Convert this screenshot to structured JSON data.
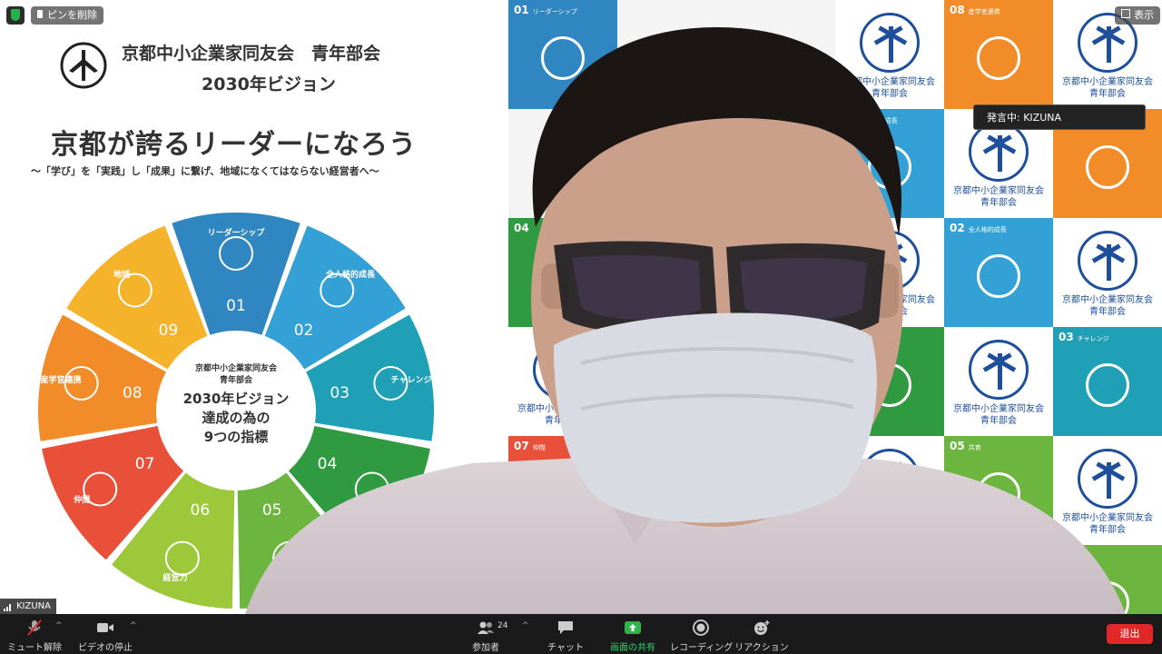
{
  "top": {
    "pin_label": "ピンを削除",
    "view_label": "表示"
  },
  "speaker_tooltip": "発言中: KIZUNA",
  "participant_name": "KIZUNA",
  "slide": {
    "org_line1": "京都中小企業家同友会　青年部会",
    "org_line2": "2030年ビジョン",
    "headline": "京都が誇るリーダーになろう",
    "subtitle": "〜「学び」を「実践」し「成果」に繋げ、地域になくてはならない経営者へ〜",
    "center_line1": "京都中小企業家同友会",
    "center_line2": "青年部会",
    "center_line3": "2030年ビジョン",
    "center_line4": "達成の為の",
    "center_line5": "9つの指標",
    "segments": [
      {
        "num": "01",
        "label": "リーダーシップ",
        "color": "#2f86c0"
      },
      {
        "num": "02",
        "label": "全人格的成長",
        "color": "#33a1d6"
      },
      {
        "num": "03",
        "label": "チャレンジ",
        "color": "#1fa0b6"
      },
      {
        "num": "04",
        "label": "",
        "color": "#2f9a3f"
      },
      {
        "num": "05",
        "label": "",
        "color": "#6cb53f"
      },
      {
        "num": "06",
        "label": "経営力",
        "color": "#9cc83a"
      },
      {
        "num": "07",
        "label": "仲間",
        "color": "#e8503a"
      },
      {
        "num": "08",
        "label": "産学官連携",
        "color": "#f28c28"
      },
      {
        "num": "09",
        "label": "地域",
        "color": "#f4b32a"
      }
    ]
  },
  "backdrop": {
    "emblem_text_1": "京都中小企業家同友会",
    "emblem_text_2": "青年部会",
    "tiles": [
      {
        "num": "01",
        "label": "リーダーシップ",
        "color": "#2f86c0"
      },
      {
        "num": "08",
        "label": "産学官連携",
        "color": "#f28c28"
      },
      {
        "num": "04",
        "label": "",
        "color": "#2f9a3f"
      },
      {
        "num": "02",
        "label": "全人格的成長",
        "color": "#33a1d6"
      },
      {
        "num": "03",
        "label": "チャレンジ",
        "color": "#1fa0b6"
      },
      {
        "num": "07",
        "label": "仲間",
        "color": "#e8503a"
      },
      {
        "num": "05",
        "label": "共育",
        "color": "#6cb53f"
      }
    ]
  },
  "toolbar": {
    "mute": "ミュート解除",
    "video": "ビデオの停止",
    "participants": "参加者",
    "participants_count": "24",
    "chat": "チャット",
    "share": "画面の共有",
    "record": "レコーディング",
    "reaction": "リアクション",
    "leave": "退出"
  }
}
